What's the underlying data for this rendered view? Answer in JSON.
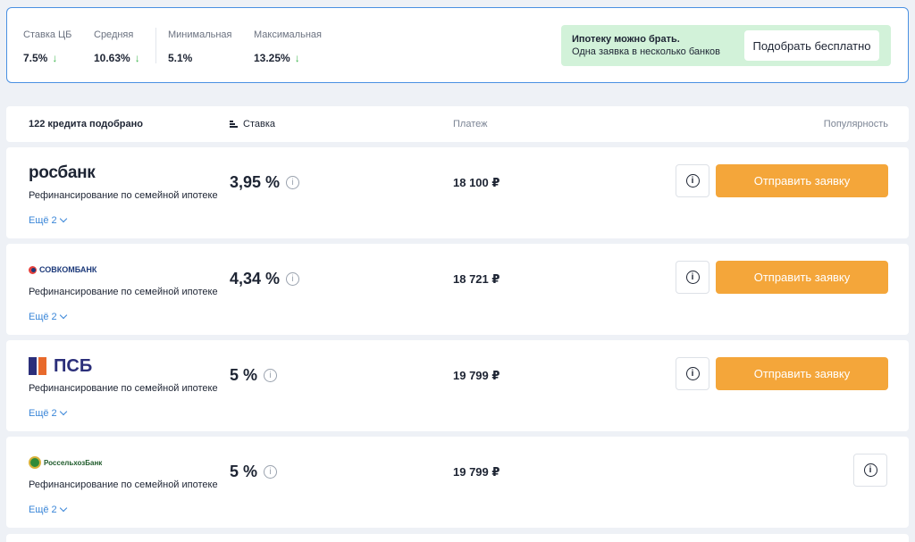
{
  "stats": [
    {
      "label": "Ставка ЦБ",
      "value": "7.5%",
      "trend": "↓"
    },
    {
      "label": "Средняя",
      "value": "10.63%",
      "trend": "↓"
    },
    {
      "label": "Минимальная",
      "value": "5.1%",
      "trend": ""
    },
    {
      "label": "Максимальная",
      "value": "13.25%",
      "trend": "↓"
    }
  ],
  "promo": {
    "title": "Ипотеку можно брать.",
    "subtitle": "Одна заявка в несколько банков",
    "button": "Подобрать бесплатно"
  },
  "list_header": {
    "count": "122 кредита подобрано",
    "rate": "Ставка",
    "payment": "Платеж",
    "popularity": "Популярность"
  },
  "offers": [
    {
      "bank": "росбанк",
      "product": "Рефинансирование по семейной ипотеке",
      "rate": "3,95 %",
      "payment": "18 100 ₽",
      "more": "Ещё 2",
      "apply": "Отправить заявку",
      "info": "i"
    },
    {
      "bank": "СОВКОМБАНК",
      "product": "Рефинансирование по семейной ипотеке",
      "rate": "4,34 %",
      "payment": "18 721 ₽",
      "more": "Ещё 2",
      "apply": "Отправить заявку",
      "info": "i"
    },
    {
      "bank": "ПСБ",
      "product": "Рефинансирование по семейной ипотеке",
      "rate": "5 %",
      "payment": "19 799 ₽",
      "more": "Ещё 2",
      "apply": "Отправить заявку",
      "info": "i"
    },
    {
      "bank": "РоссельхозБанк",
      "product": "Рефинансирование по семейной ипотеке",
      "rate": "5 %",
      "payment": "19 799 ₽",
      "more": "Ещё 2",
      "apply": "",
      "info": "i"
    }
  ],
  "colors": {
    "accent": "#f4a63a",
    "link": "#3a86d8",
    "promo_bg": "#d2f2d9",
    "trend_down": "#3fb64f",
    "border_active": "#4a90e2"
  }
}
